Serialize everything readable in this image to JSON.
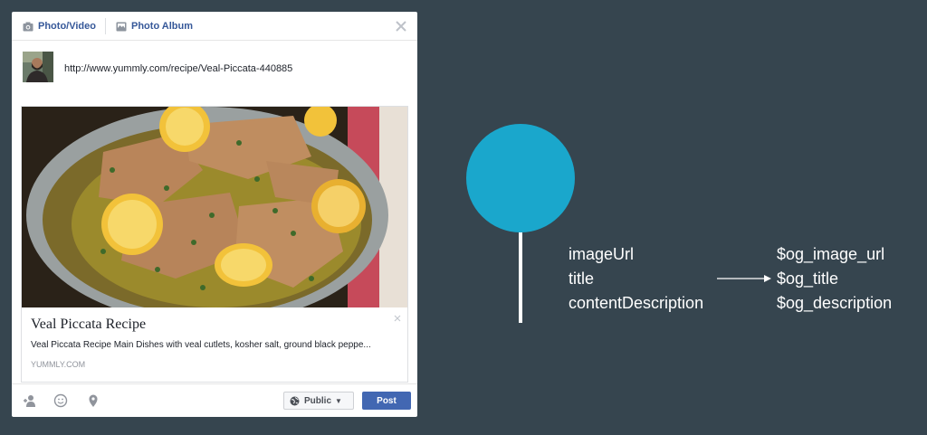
{
  "composer": {
    "tabs": [
      {
        "label": "Photo/Video",
        "icon": "camera-icon"
      },
      {
        "label": "Photo Album",
        "icon": "album-icon"
      }
    ],
    "url_value": "http://www.yummly.com/recipe/Veal-Piccata-440885",
    "link_preview": {
      "title": "Veal Piccata Recipe",
      "description": "Veal Piccata Recipe Main Dishes with veal cutlets, kosher salt, ground black peppe...",
      "domain": "YUMMLY.COM"
    },
    "footer": {
      "icons": [
        "tag-friends-icon",
        "feeling-icon",
        "location-icon"
      ],
      "audience_label": "Public",
      "post_label": "Post"
    }
  },
  "mapping": {
    "fields": [
      "imageUrl",
      "title",
      "contentDescription"
    ],
    "og_fields": [
      "$og_image_url",
      "$og_title",
      "$og_description"
    ]
  },
  "colors": {
    "background": "#36454f",
    "accent_circle": "#1aa7cc",
    "post_button": "#4267b2",
    "link_blue": "#365899"
  }
}
